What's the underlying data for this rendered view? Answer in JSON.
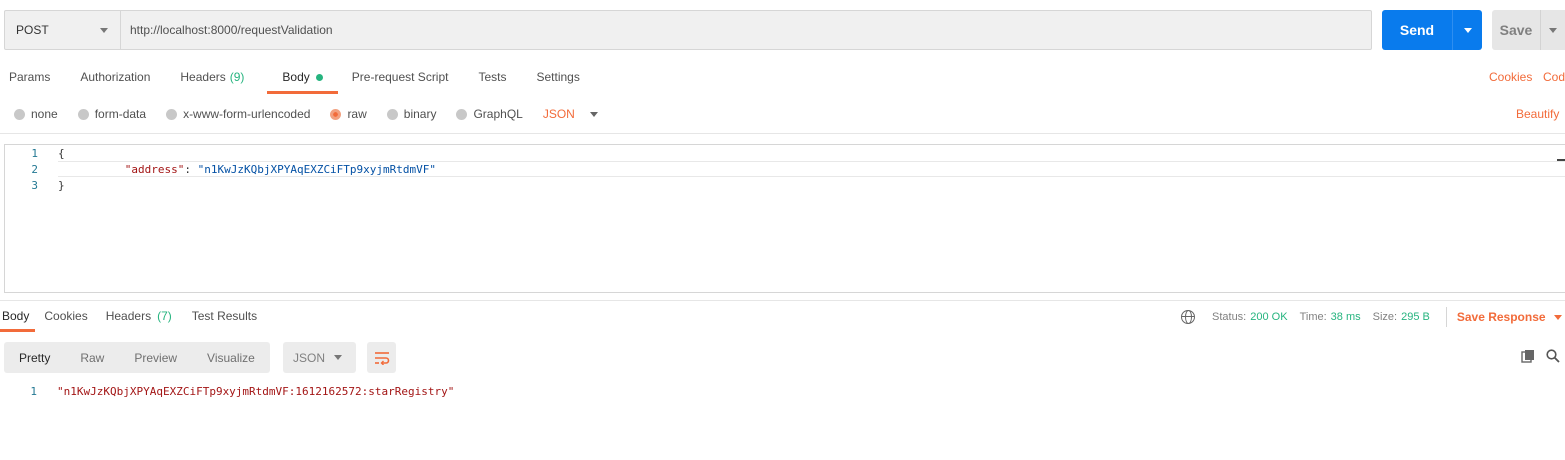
{
  "request": {
    "method": "POST",
    "url": "http://localhost:8000/requestValidation",
    "send_label": "Send",
    "save_label": "Save"
  },
  "request_tabs": [
    {
      "label": "Params"
    },
    {
      "label": "Authorization"
    },
    {
      "label": "Headers",
      "count": "(9)"
    },
    {
      "label": "Body"
    },
    {
      "label": "Pre-request Script"
    },
    {
      "label": "Tests"
    },
    {
      "label": "Settings"
    }
  ],
  "links": {
    "cookies": "Cookies",
    "code": "Code",
    "beautify": "Beautify"
  },
  "body_types": [
    {
      "label": "none"
    },
    {
      "label": "form-data"
    },
    {
      "label": "x-www-form-urlencoded"
    },
    {
      "label": "raw"
    },
    {
      "label": "binary"
    },
    {
      "label": "GraphQL"
    }
  ],
  "body_format": "JSON",
  "editor": {
    "lines": [
      {
        "num": "1",
        "open": "{"
      },
      {
        "num": "2",
        "key": "\"address\"",
        "sep": ": ",
        "value": "\"n1KwJzKQbjXPYAqEXZCiFTp9xyjmRtdmVF\""
      },
      {
        "num": "3",
        "close": "}"
      }
    ]
  },
  "response_tabs": [
    {
      "label": "Body"
    },
    {
      "label": "Cookies"
    },
    {
      "label": "Headers",
      "count": "(7)"
    },
    {
      "label": "Test Results"
    }
  ],
  "status": {
    "status_label": "Status:",
    "status_value": "200 OK",
    "time_label": "Time:",
    "time_value": "38 ms",
    "size_label": "Size:",
    "size_value": "295 B",
    "save_response": "Save Response"
  },
  "view_modes": [
    {
      "label": "Pretty"
    },
    {
      "label": "Raw"
    },
    {
      "label": "Preview"
    },
    {
      "label": "Visualize"
    }
  ],
  "response_format": "JSON",
  "response_body": {
    "num": "1",
    "text": "\"n1KwJzKQbjXPYAqEXZCiFTp9xyjmRtdmVF:1612162572:starRegistry\""
  },
  "colors": {
    "accent": "#f26b3a",
    "send_blue": "#097bed",
    "success_green": "#26b47f"
  }
}
